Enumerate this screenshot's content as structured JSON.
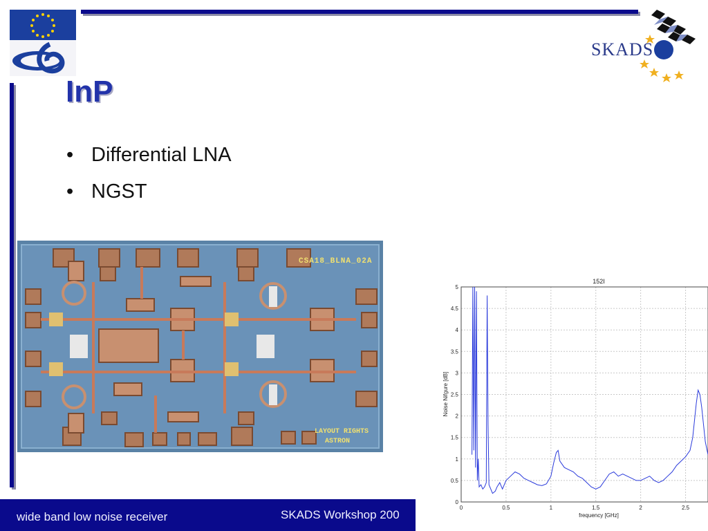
{
  "slide": {
    "title": "InP",
    "bullets": [
      "Differential LNA",
      "NGST"
    ]
  },
  "logos": {
    "left_icon": "eu-fp6-logo",
    "right_text": "SKADS"
  },
  "chip": {
    "label": "CSA18_BLNA_02A",
    "note_line1": "LAYOUT RIGHTS",
    "note_line2": "ASTRON"
  },
  "footer": {
    "left_text": "wide band low noise receiver",
    "right_text": "SKADS Workshop 200"
  },
  "colors": {
    "accent": "#0a0a8c",
    "title": "#2233aa",
    "plot_line": "#2a3adb"
  },
  "chart_data": {
    "type": "line",
    "title": "152I",
    "xlabel": "frequency [GHz]",
    "ylabel": "Noise Nifgure [dB]",
    "xlim": [
      0,
      2.75
    ],
    "ylim": [
      0,
      5
    ],
    "xticks": [
      "0",
      "0.5",
      "1",
      "1.5",
      "2",
      "2.5"
    ],
    "yticks": [
      "0",
      "0.5",
      "1",
      "1.5",
      "2",
      "2.5",
      "3",
      "3.5",
      "4",
      "4.5",
      "5"
    ],
    "grid": true,
    "series": [
      {
        "x": [
          0.12,
          0.13,
          0.14,
          0.15,
          0.16,
          0.17,
          0.18,
          0.19,
          0.2,
          0.22,
          0.24,
          0.26,
          0.28,
          0.29,
          0.3,
          0.31,
          0.33,
          0.35,
          0.38,
          0.4,
          0.43,
          0.46,
          0.5,
          0.55,
          0.6,
          0.65,
          0.7,
          0.75,
          0.8,
          0.85,
          0.9,
          0.95,
          1.0,
          1.03,
          1.06,
          1.08,
          1.1,
          1.15,
          1.2,
          1.25,
          1.3,
          1.35,
          1.4,
          1.45,
          1.5,
          1.55,
          1.6,
          1.65,
          1.7,
          1.75,
          1.8,
          1.85,
          1.9,
          1.95,
          2.0,
          2.05,
          2.1,
          2.15,
          2.2,
          2.25,
          2.3,
          2.35,
          2.4,
          2.45,
          2.5,
          2.55,
          2.58,
          2.6,
          2.62,
          2.64,
          2.66,
          2.68,
          2.7,
          2.72,
          2.75
        ],
        "y": [
          1.1,
          5.0,
          1.2,
          5.0,
          0.8,
          4.9,
          0.5,
          1.0,
          0.35,
          0.4,
          0.3,
          0.35,
          0.45,
          4.8,
          1.8,
          0.4,
          0.3,
          0.2,
          0.25,
          0.35,
          0.45,
          0.3,
          0.5,
          0.6,
          0.7,
          0.65,
          0.55,
          0.5,
          0.45,
          0.4,
          0.38,
          0.42,
          0.6,
          0.9,
          1.15,
          1.2,
          0.95,
          0.8,
          0.75,
          0.7,
          0.6,
          0.55,
          0.45,
          0.35,
          0.3,
          0.35,
          0.5,
          0.65,
          0.7,
          0.6,
          0.65,
          0.6,
          0.55,
          0.5,
          0.5,
          0.55,
          0.6,
          0.5,
          0.45,
          0.5,
          0.6,
          0.7,
          0.85,
          0.95,
          1.05,
          1.2,
          1.5,
          1.9,
          2.3,
          2.6,
          2.5,
          2.2,
          1.8,
          1.4,
          1.1
        ]
      }
    ]
  }
}
